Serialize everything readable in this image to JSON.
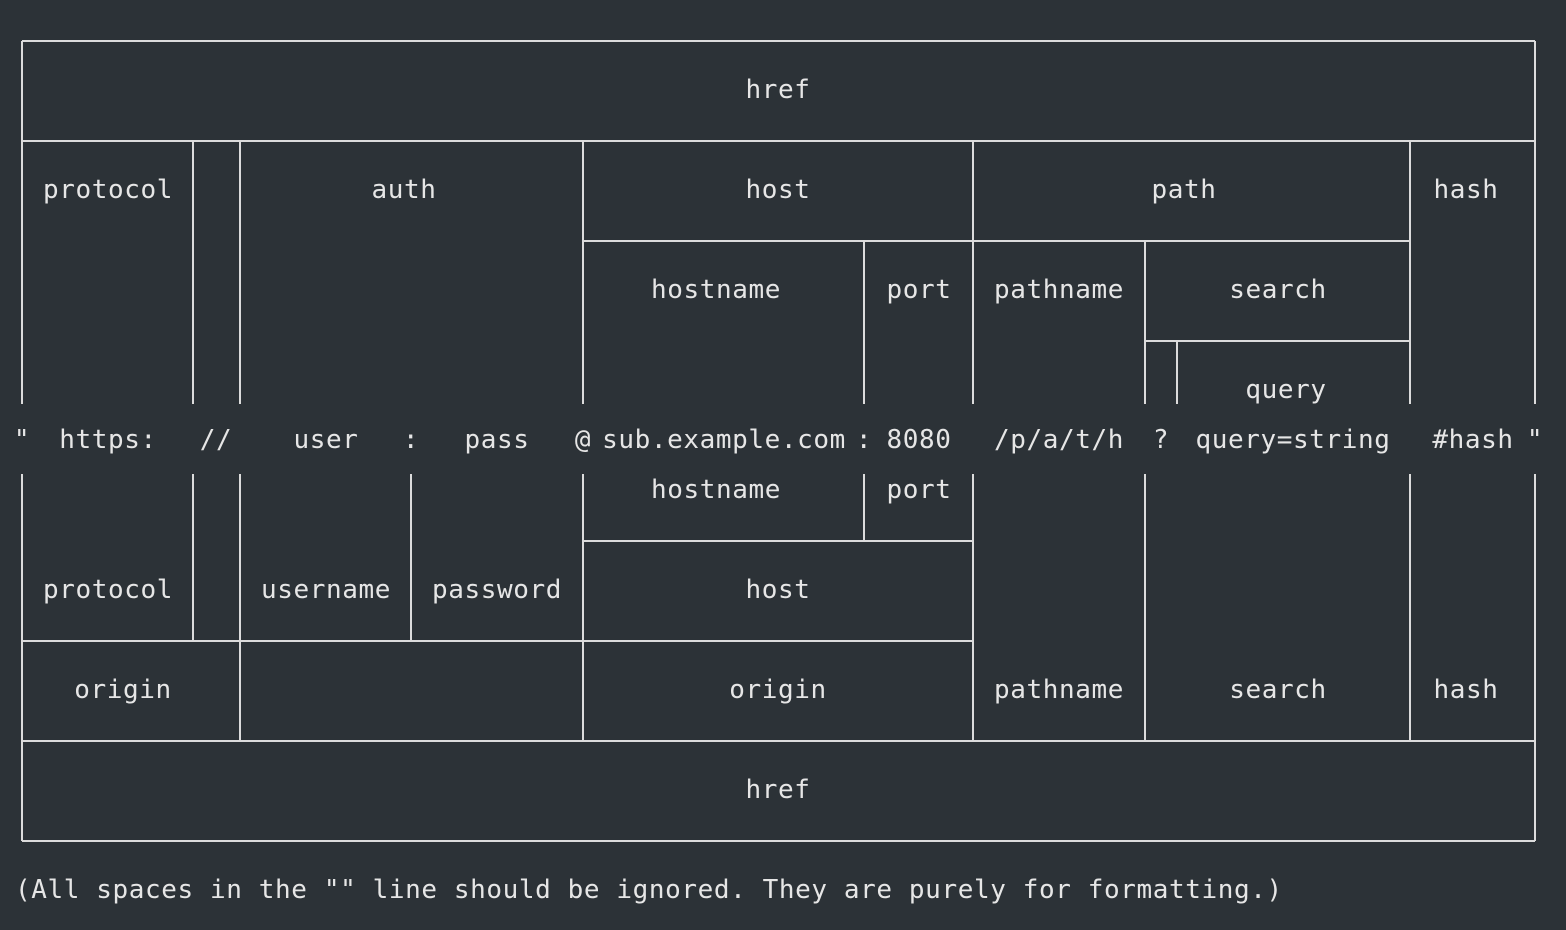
{
  "upper": {
    "href": "href",
    "protocol": "protocol",
    "auth": "auth",
    "host": "host",
    "path": "path",
    "hash": "hash",
    "hostname": "hostname",
    "port": "port",
    "pathname": "pathname",
    "search": "search",
    "query": "query"
  },
  "url": {
    "open_quote": "\"",
    "protocol": "https:",
    "slashes": "//",
    "user": "user",
    "colon1": ":",
    "pass": "pass",
    "at": "@",
    "hostname": "sub.example.com",
    "colon2": ":",
    "port": "8080",
    "pathname": "/p/a/t/h",
    "question": "?",
    "query": "query=string",
    "hash": "#hash",
    "close_quote": "\""
  },
  "lower": {
    "hostname": "hostname",
    "port": "port",
    "protocol": "protocol",
    "username": "username",
    "password": "password",
    "host": "host",
    "origin_left": "origin",
    "origin_mid": "origin",
    "pathname": "pathname",
    "search": "search",
    "hash": "hash",
    "href": "href"
  },
  "note": "(All spaces in the \"\" line should be ignored. They are purely for formatting.)"
}
